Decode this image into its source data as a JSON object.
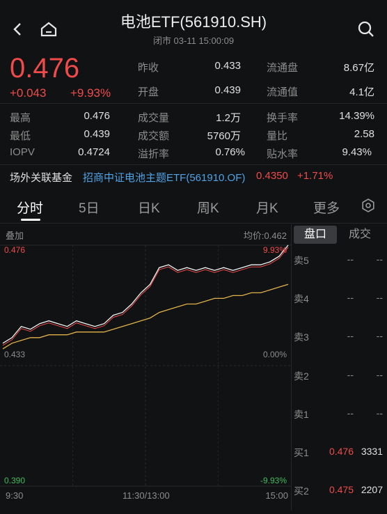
{
  "header": {
    "title": "电池ETF(561910.SH)",
    "subtitle": "闭市 03-11 15:00:09"
  },
  "quote": {
    "price": "0.476",
    "change": "+0.043",
    "change_pct": "+9.93%",
    "rows": [
      {
        "l1": "昨收",
        "v1": "0.433",
        "l2": "流通盘",
        "v2": "8.67亿"
      },
      {
        "l1": "开盘",
        "v1": "0.439",
        "l2": "流通值",
        "v2": "4.1亿"
      }
    ],
    "grid": [
      {
        "a": "最高",
        "av": "0.476",
        "b": "成交量",
        "bv": "1.2万",
        "c": "换手率",
        "cv": "14.39%"
      },
      {
        "a": "最低",
        "av": "0.439",
        "b": "成交额",
        "bv": "5760万",
        "c": "量比",
        "cv": "2.58"
      },
      {
        "a": "IOPV",
        "av": "0.4724",
        "b": "溢折率",
        "bv": "0.76%",
        "c": "贴水率",
        "cv": "9.43%"
      }
    ]
  },
  "fund_link": {
    "label": "场外关联基金",
    "name": "招商中证电池主题ETF(561910.OF)",
    "price": "0.4350",
    "pct": "+1.71%"
  },
  "tabs": [
    "分时",
    "5日",
    "日K",
    "周K",
    "月K",
    "更多"
  ],
  "chart": {
    "overlay_label": "叠加",
    "avg_label": "均价:0.462",
    "top_left": "0.476",
    "top_right": "9.93%",
    "mid_left": "0.433",
    "mid_right": "0.00%",
    "bottom_left": "0.390",
    "bottom_right": "-9.93%",
    "time_start": "9:30",
    "time_mid": "11:30/13:00",
    "time_end": "15:00"
  },
  "chart_data": {
    "type": "line",
    "title": "",
    "xlabel": "",
    "ylabel": "",
    "ylim": [
      0.39,
      0.476
    ],
    "x_ticks": [
      "9:30",
      "11:30/13:00",
      "15:00"
    ],
    "series": [
      {
        "name": "price",
        "values": [
          0.441,
          0.443,
          0.447,
          0.446,
          0.448,
          0.449,
          0.448,
          0.447,
          0.449,
          0.448,
          0.447,
          0.448,
          0.451,
          0.452,
          0.455,
          0.459,
          0.462,
          0.468,
          0.469,
          0.467,
          0.468,
          0.467,
          0.468,
          0.467,
          0.468,
          0.467,
          0.468,
          0.469,
          0.469,
          0.47,
          0.472,
          0.476
        ]
      },
      {
        "name": "avg",
        "values": [
          0.439,
          0.441,
          0.442,
          0.443,
          0.443,
          0.444,
          0.444,
          0.444,
          0.445,
          0.445,
          0.445,
          0.445,
          0.446,
          0.447,
          0.448,
          0.449,
          0.45,
          0.452,
          0.453,
          0.454,
          0.455,
          0.455,
          0.456,
          0.457,
          0.457,
          0.458,
          0.458,
          0.459,
          0.459,
          0.46,
          0.461,
          0.462
        ]
      }
    ]
  },
  "orderbook": {
    "tab_active": "盘口",
    "tab_other": "成交",
    "rows": [
      {
        "label": "卖5",
        "price": "--",
        "vol": "--"
      },
      {
        "label": "卖4",
        "price": "--",
        "vol": "--"
      },
      {
        "label": "卖3",
        "price": "--",
        "vol": "--"
      },
      {
        "label": "卖2",
        "price": "--",
        "vol": "--"
      },
      {
        "label": "卖1",
        "price": "--",
        "vol": "--"
      },
      {
        "label": "买1",
        "price": "0.476",
        "vol": "3331"
      },
      {
        "label": "买2",
        "price": "0.475",
        "vol": "2207"
      }
    ]
  },
  "colors": {
    "up": "#f04b4b",
    "down": "#3ebd5f",
    "avg": "#e2b24a",
    "price": "#f4f4f4"
  }
}
